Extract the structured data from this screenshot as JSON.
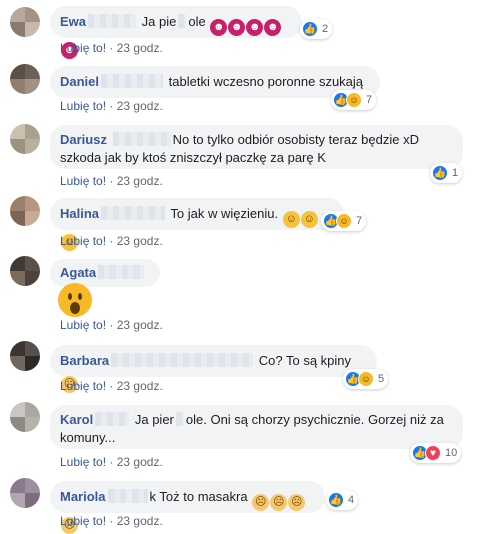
{
  "meta": {
    "like_label": "Lubię to!",
    "separator": "·",
    "time": "23 godz."
  },
  "comments": [
    {
      "name": "Ewa",
      "pre_text": "Ja pie",
      "text": "ole",
      "emoji": "devil-face-icon x5",
      "reactions": "2",
      "reaction_types": [
        "like"
      ]
    },
    {
      "name": "Daniel",
      "text": "tabletki wczesno poronne szukają",
      "reactions": "7",
      "reaction_types": [
        "like",
        "haha"
      ]
    },
    {
      "name": "Dariusz",
      "text_line1": "No to tylko odbiór osobisty teraz będzie xD",
      "text_line2": "szkoda jak by ktoś zniszczył paczkę za parę K",
      "reactions": "1",
      "reaction_types": [
        "like"
      ]
    },
    {
      "name": "Halina",
      "text": "To jak w więzieniu.",
      "emoji": "laughing-face-icon x3",
      "reactions": "7",
      "reaction_types": [
        "like",
        "haha"
      ]
    },
    {
      "name": "Agata",
      "emoji": "wow-face-icon"
    },
    {
      "name": "Barbara",
      "text": "Co? To są kpiny",
      "emoji": "squint-face-icon",
      "reactions": "5",
      "reaction_types": [
        "like",
        "haha"
      ]
    },
    {
      "name": "Karol",
      "pre_text": "Ja pier",
      "text_line1": "ole. Oni są chorzy psychicznie. Gorzej niż za",
      "text_line2": "komuny...",
      "reactions": "10",
      "reaction_types": [
        "like",
        "love"
      ]
    },
    {
      "name": "Mariola",
      "pre_text": "k",
      "text": "Toż to masakra",
      "emoji": "squint-face-icon x4",
      "reactions": "4",
      "reaction_types": [
        "like"
      ]
    }
  ],
  "colors": {
    "name": "#385898",
    "bubble": "#f2f3f5",
    "like": "#1877f2",
    "love": "#f33e58",
    "haha": "#f7b928"
  }
}
